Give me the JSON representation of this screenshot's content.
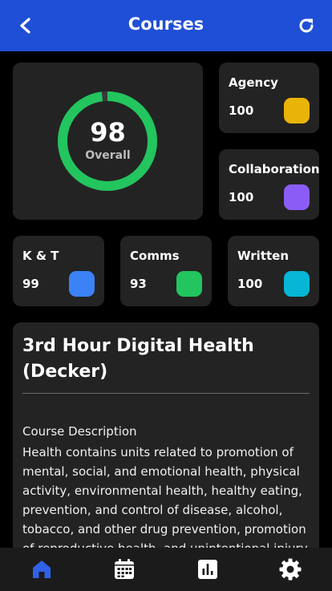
{
  "header": {
    "title": "Courses"
  },
  "overall": {
    "score": "98",
    "label": "Overall",
    "percent": 98,
    "color": "#22c55e"
  },
  "scores": {
    "agency": {
      "label": "Agency",
      "value": "100",
      "color": "#eab308"
    },
    "collaboration": {
      "label": "Collaboration",
      "value": "100",
      "color": "#8b5cf6"
    },
    "kt": {
      "label": "K & T",
      "value": "99",
      "color": "#3b82f6"
    },
    "comms": {
      "label": "Comms",
      "value": "93",
      "color": "#22c55e"
    },
    "written": {
      "label": "Written",
      "value": "100",
      "color": "#06b6d4"
    }
  },
  "course": {
    "title": "3rd Hour Digital Health (Decker)",
    "description_heading": "Course Description",
    "description": "Health contains units related to promotion of mental, social, and emotional health, physical activity, environmental health, healthy eating, prevention, and control of disease, alcohol, tobacco, and other drug prevention, promotion of reproductive health, and unintentional injury"
  },
  "nav": {
    "items": [
      {
        "icon": "home-icon",
        "active": true
      },
      {
        "icon": "calendar-icon",
        "active": false
      },
      {
        "icon": "bar-chart-icon",
        "active": false
      },
      {
        "icon": "settings-icon",
        "active": false
      }
    ],
    "active_color": "#2f62e8"
  }
}
